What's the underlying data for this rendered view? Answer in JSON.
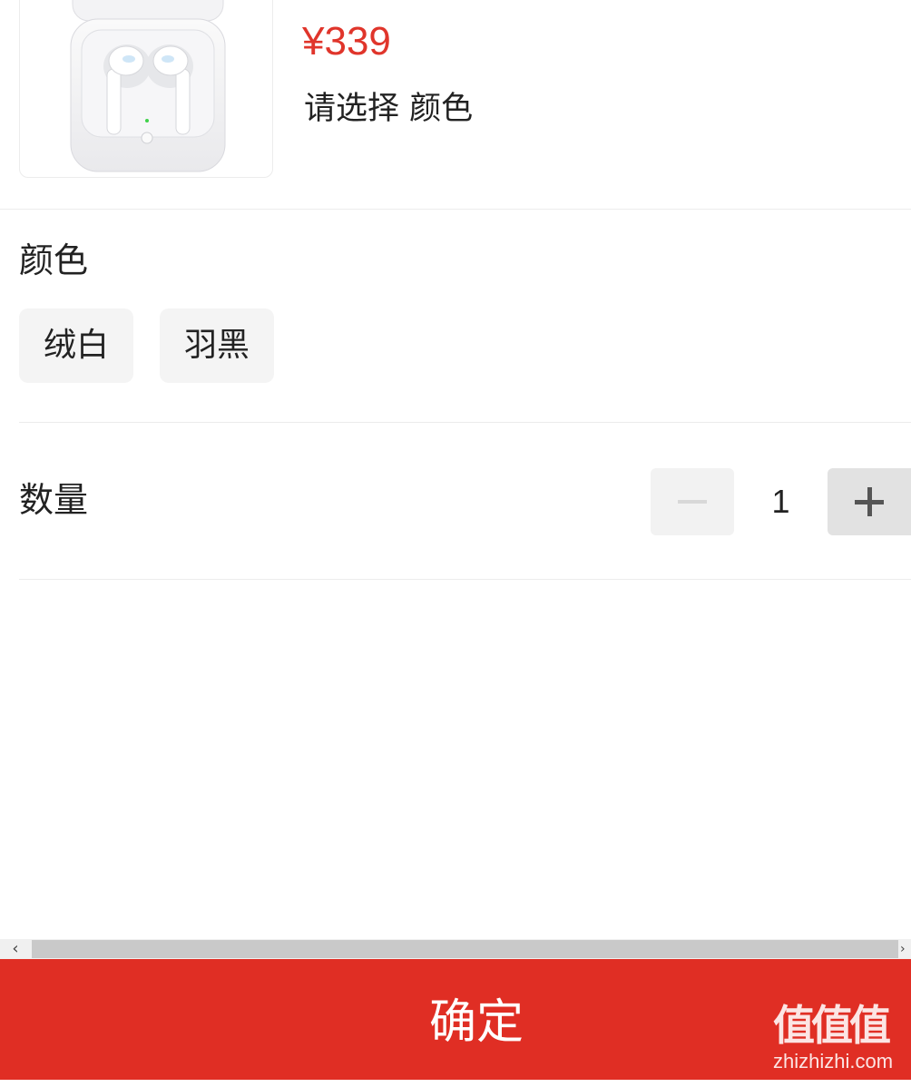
{
  "product": {
    "image": "wireless-earbuds-charging-case-white",
    "price": "¥339",
    "select_hint": "请选择 颜色"
  },
  "color_section": {
    "title": "颜色",
    "options": [
      {
        "label": "绒白"
      },
      {
        "label": "羽黑"
      }
    ]
  },
  "quantity_section": {
    "title": "数量",
    "value": "1",
    "minus_icon": "minus-icon",
    "plus_icon": "plus-icon"
  },
  "scrollbar": {
    "left_arrow": "‹",
    "right_arrow": "›"
  },
  "confirm": {
    "label": "确定"
  },
  "watermark": {
    "glyphs": "值值值",
    "domain": "zhizhizhi.com"
  },
  "colors": {
    "accent": "#e02e24",
    "price": "#e0352b"
  }
}
